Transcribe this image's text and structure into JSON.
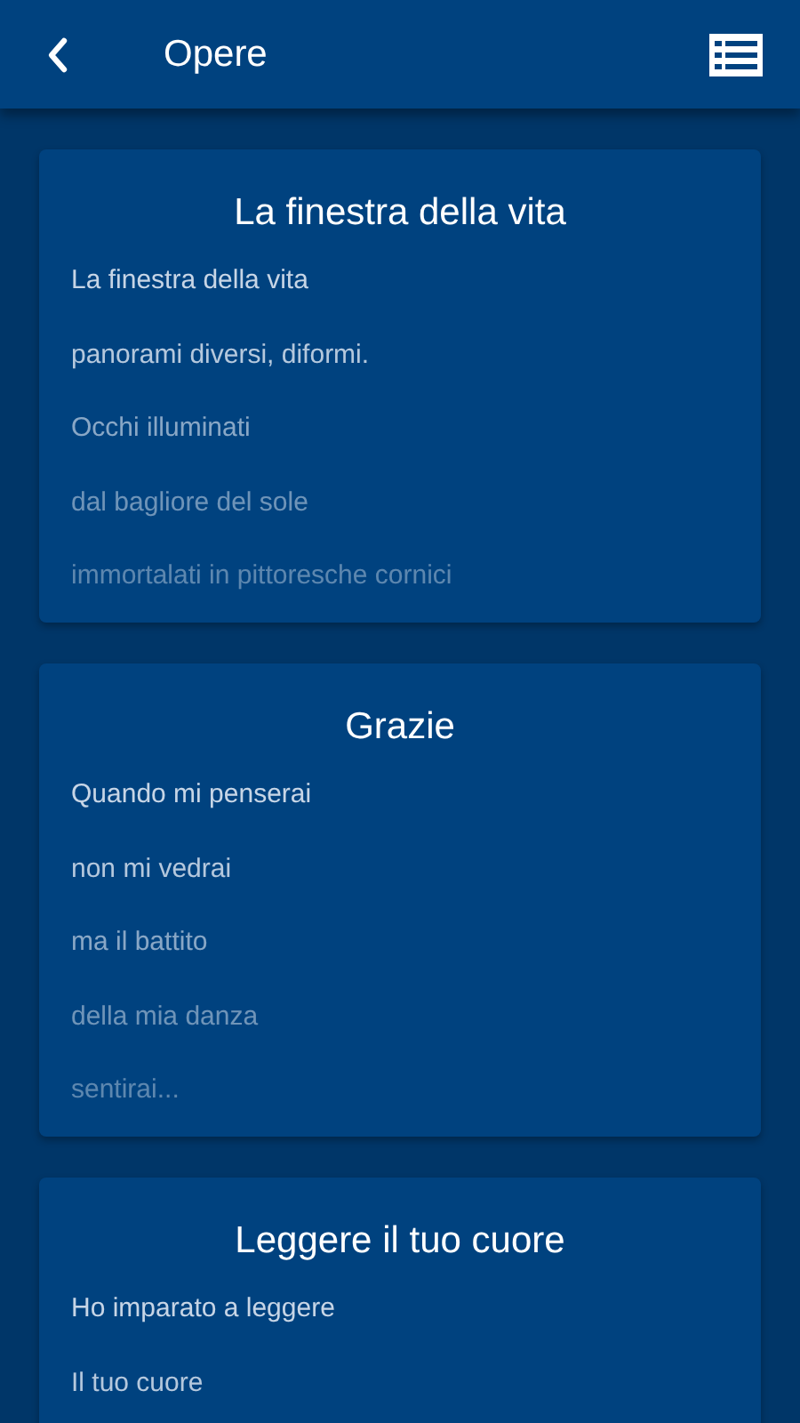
{
  "app_bar": {
    "title": "Opere"
  },
  "poems": [
    {
      "title": "La finestra della vita",
      "lines": [
        "La finestra della vita",
        "panorami diversi, diformi.",
        "Occhi illuminati",
        "dal bagliore del sole",
        "immortalati in pittoresche cornici"
      ]
    },
    {
      "title": "Grazie",
      "lines": [
        "Quando mi penserai",
        "non mi vedrai",
        "ma il battito",
        "della mia danza",
        "sentirai..."
      ]
    },
    {
      "title": "Leggere il tuo cuore",
      "lines": [
        "Ho imparato a leggere",
        "Il tuo cuore"
      ]
    }
  ]
}
